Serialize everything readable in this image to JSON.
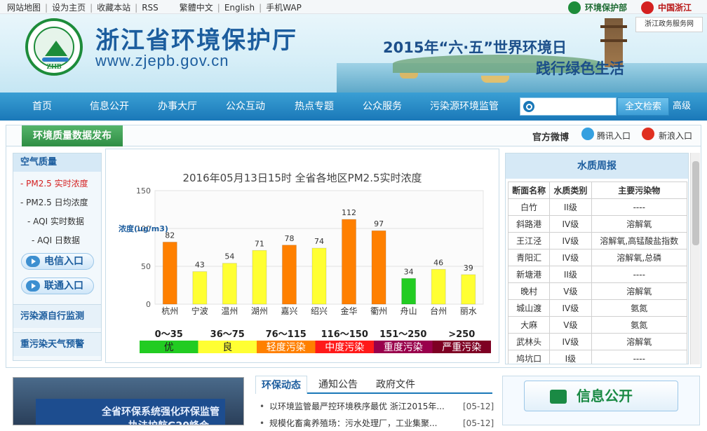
{
  "top_links": [
    "网站地图",
    "设为主页",
    "收藏本站",
    "RSS",
    "繁體中文",
    "English",
    "手机WAP"
  ],
  "right_links": {
    "env": "环境保护部",
    "cn": "中国浙江",
    "gov": "浙江政务服务网"
  },
  "site": {
    "name": "浙江省环境保护厅",
    "url": "www.zjepb.gov.cn",
    "logo_text": "ZHB"
  },
  "slogan": {
    "line1": "2015年“六·五”世界环境日",
    "line2": "践行绿色生活"
  },
  "nav": {
    "items": [
      "首页",
      "信息公开",
      "办事大厅",
      "公众互动",
      "热点专题",
      "公众服务",
      "污染源环境监管"
    ],
    "search_btn": "全文检索",
    "advanced": "高级"
  },
  "panel": {
    "tab": "环境质量数据发布",
    "weibo": "官方微博",
    "tencent": "腾讯入口",
    "sina": "新浪入口"
  },
  "sidebar": {
    "head": "空气质量",
    "items": [
      "- PM2.5 实时浓度",
      "- PM2.5 日均浓度",
      "- AQI 实时数据",
      "- AQI 日数据"
    ],
    "btn_telecom": "电信入口",
    "btn_unicom": "联通入口",
    "link1": "污染源自行监测",
    "link2": "重污染天气预警"
  },
  "chart_data": {
    "type": "bar",
    "title": "2016年05月13日15时 全省各地区PM2.5实时浓度",
    "ylabel": "浓度(ug/m3)",
    "ylim": [
      0,
      150
    ],
    "yticks": [
      0,
      50,
      100,
      150
    ],
    "categories": [
      "杭州",
      "宁波",
      "温州",
      "湖州",
      "嘉兴",
      "绍兴",
      "金华",
      "衢州",
      "舟山",
      "台州",
      "丽水"
    ],
    "values": [
      82,
      43,
      54,
      71,
      78,
      74,
      112,
      97,
      34,
      46,
      39
    ],
    "colors": [
      "#ff8000",
      "#ffff33",
      "#ffff33",
      "#ffff33",
      "#ff8000",
      "#ffff33",
      "#ff8000",
      "#ff8000",
      "#22cc22",
      "#ffff33",
      "#ffff33"
    ],
    "legend": [
      {
        "range": "0～35",
        "label": "优",
        "color": "#22cc22"
      },
      {
        "range": "36～75",
        "label": "良",
        "color": "#ffff33"
      },
      {
        "range": "76～115",
        "label": "轻度污染",
        "color": "#ff8000"
      },
      {
        "range": "116～150",
        "label": "中度污染",
        "color": "#ff1a1a"
      },
      {
        "range": "151～250",
        "label": "重度污染",
        "color": "#99004c"
      },
      {
        "range": ">250",
        "label": "严重污染",
        "color": "#7e0023"
      }
    ]
  },
  "water": {
    "head": "水质周报",
    "columns": [
      "断面名称",
      "水质类别",
      "主要污染物"
    ],
    "rows": [
      [
        "白竹",
        "II级",
        "----"
      ],
      [
        "斜路港",
        "IV级",
        "溶解氧"
      ],
      [
        "王江泾",
        "IV级",
        "溶解氧,高锰酸盐指数"
      ],
      [
        "青阳汇",
        "IV级",
        "溶解氧,总磷"
      ],
      [
        "新塘港",
        "II级",
        "----"
      ],
      [
        "晚村",
        "V级",
        "溶解氧"
      ],
      [
        "城山渡",
        "IV级",
        "氨氮"
      ],
      [
        "大麻",
        "V级",
        "氨氮"
      ],
      [
        "武林头",
        "IV级",
        "溶解氧"
      ],
      [
        "鸠坑口",
        "I级",
        "----"
      ]
    ]
  },
  "photo": {
    "line1": "全省环保系统强化环保监管",
    "line2": "执法护航G20峰会"
  },
  "news": {
    "tabs": [
      "环保动态",
      "通知公告",
      "政府文件"
    ],
    "items": [
      {
        "title": "以环境监管最严控环境秩序最优 浙江2015年...",
        "date": "[05-12]"
      },
      {
        "title": "规模化畜禽养殖场：污水处理厂，工业集聚...",
        "date": "[05-12]"
      }
    ]
  },
  "info": {
    "label": "信息公开"
  }
}
